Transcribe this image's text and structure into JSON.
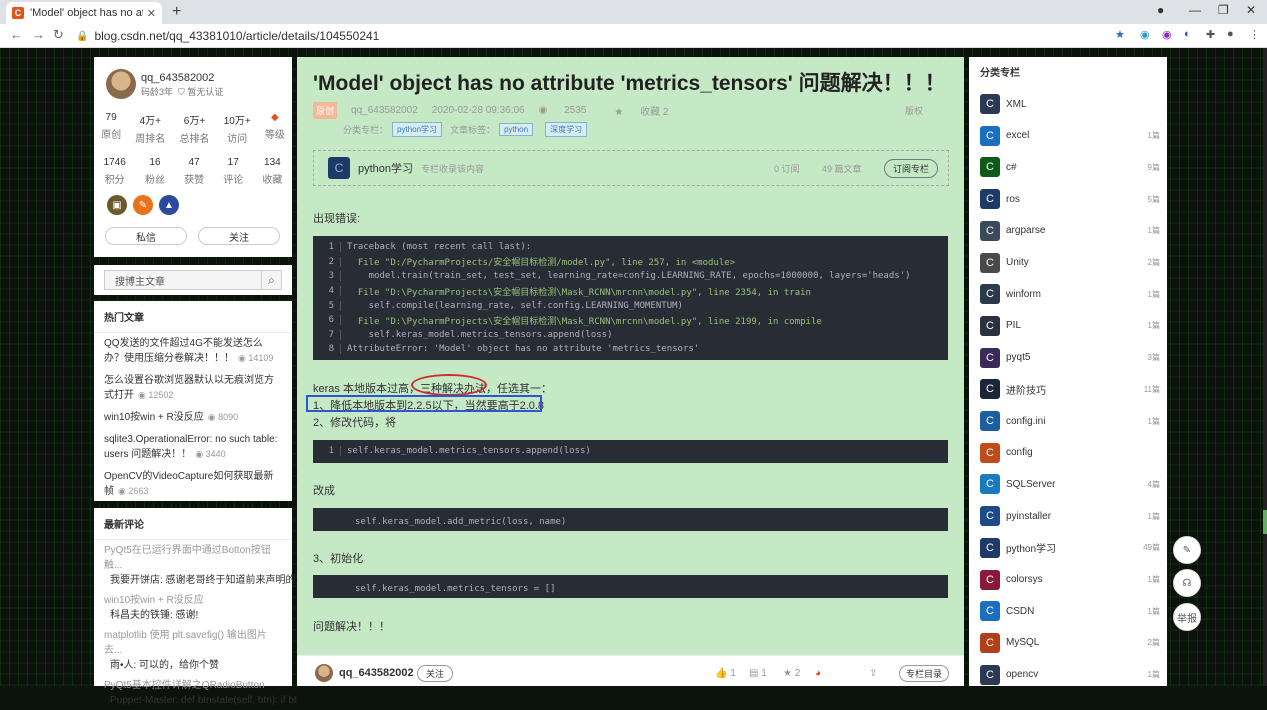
{
  "browser": {
    "tab_title": "'Model' object has no attribut",
    "tab_favicon": "C",
    "tab_close": "✕",
    "new_tab": "+",
    "url": "blog.csdn.net/qq_43381010/article/details/104550241",
    "icons": [
      "back-icon",
      "forward-icon",
      "reload-icon",
      "lock-icon",
      "star-icon",
      "extension-icon",
      "profile-icon",
      "menu-icon"
    ]
  },
  "profile": {
    "username": "qq_643582002",
    "code_age": "码龄3年",
    "verify": "暂无认证",
    "stats_row1": [
      {
        "value": "79",
        "label": "原创"
      },
      {
        "value": "4万+",
        "label": "周排名"
      },
      {
        "value": "6万+",
        "label": "总排名"
      },
      {
        "value": "10万+",
        "label": "访问"
      },
      {
        "value": "",
        "label": "等级"
      }
    ],
    "stats_row2": [
      {
        "value": "1746",
        "label": "积分"
      },
      {
        "value": "16",
        "label": "粉丝"
      },
      {
        "value": "47",
        "label": "获赞"
      },
      {
        "value": "17",
        "label": "评论"
      },
      {
        "value": "134",
        "label": "收藏"
      }
    ],
    "message_btn": "私信",
    "follow_btn": "关注"
  },
  "search": {
    "placeholder": "搜博主文章"
  },
  "hot": {
    "title": "热门文章",
    "items": [
      {
        "title": "QQ发送的文件超过4G不能发送怎么办？使用压缩分卷解决！！！",
        "count": "14109"
      },
      {
        "title": "怎么设置谷歌浏览器默认以无痕浏览方式打开",
        "count": "12502"
      },
      {
        "title": "win10按win + R没反应",
        "count": "8090"
      },
      {
        "title": "sqlite3.OperationalError: no such table: users 问题解决！！",
        "count": "3440"
      },
      {
        "title": "OpenCV的VideoCapture如何获取最新帧",
        "count": "2663"
      }
    ]
  },
  "latest": {
    "title": "最新评论",
    "items": [
      {
        "title": "PyQt5在已运行界面中通过Botton按钮触...",
        "comment": "我要开饼店: 感谢老哥终于知道前来声明的为什么都看不到了 hhh"
      },
      {
        "title": "win10按win + R没反应",
        "comment": "科昌夫的铁锤: 感谢!"
      },
      {
        "title": "matplotlib 使用 plt.savefig() 输出图片去...",
        "comment": "雨•人: 可以的，给你个赞"
      },
      {
        "title": "PyQt5基本控件详解之QRadioButton",
        "comment": "Puppet-Master: def btnstate(self, btn): if bt"
      }
    ]
  },
  "article": {
    "title": "'Model' object has no attribute 'metrics_tensors' 问题解决！！！",
    "original": "原创",
    "author": "qq_643582002",
    "date": "2020-02-28 09:36:06",
    "views": "2535",
    "favorites": "收藏 2",
    "copyright": "版权",
    "category_label": "分类专栏：",
    "category": "python学习",
    "tags_label": "文章标签：",
    "tags": [
      "python",
      "深度学习"
    ],
    "column": {
      "name": "python学习",
      "desc": "专栏收录该内容",
      "subs": "0 订阅",
      "count": "49 篇文章",
      "btn": "订阅专栏"
    },
    "p_error": "出现错误:",
    "code1": [
      [
        "1",
        "Traceback (most recent call last):"
      ],
      [
        "2",
        "  File \"D:/PycharmProjects/安全帽目标检测/model.py\", line 257, in <module>"
      ],
      [
        "3",
        "    model.train(train_set, test_set, learning_rate=config.LEARNING_RATE, epochs=1000000, layers='heads')"
      ],
      [
        "4",
        "  File \"D:\\PycharmProjects\\安全帽目标检测\\Mask_RCNN\\mrcnn\\model.py\", line 2354, in train"
      ],
      [
        "5",
        "    self.compile(learning_rate, self.config.LEARNING_MOMENTUM)"
      ],
      [
        "6",
        "  File \"D:\\PycharmProjects\\安全帽目标检测\\Mask_RCNN\\mrcnn\\model.py\", line 2199, in compile"
      ],
      [
        "7",
        "    self.keras_model.metrics_tensors.append(loss)"
      ],
      [
        "8",
        "AttributeError: 'Model' object has no attribute 'metrics_tensors'"
      ]
    ],
    "p_keras_a": "keras 本地版本过高，",
    "p_keras_b": "三种解决办法",
    "p_keras_c": "，任选其一：",
    "p_opt1": "1、降低本地版本到2.2.5以下，当然要高于2.0.8",
    "p_opt2": "2、修改代码，将",
    "code2": [
      [
        "1",
        "self.keras_model.metrics_tensors.append(loss)"
      ]
    ],
    "p_change": "改成",
    "code3": "self.keras_model.add_metric(loss, name)",
    "p_opt3": "3、初始化",
    "code4": "self.keras_model.metrics_tensors = []",
    "p_done": "问题解决！！！"
  },
  "bottom": {
    "author": "qq_643582002",
    "follow": "关注",
    "likes": "1",
    "comments": "1",
    "stars": "2",
    "directory": "专栏目录"
  },
  "columns": {
    "title": "分类专栏",
    "items": [
      {
        "name": "XML",
        "count": "",
        "color": "#2a3a55"
      },
      {
        "name": "excel",
        "count": "1篇",
        "color": "#1a6fc0"
      },
      {
        "name": "c#",
        "count": "9篇",
        "color": "#0f5a18"
      },
      {
        "name": "ros",
        "count": "5篇",
        "color": "#1d3b66"
      },
      {
        "name": "argparse",
        "count": "1篇",
        "color": "#3a4a5a"
      },
      {
        "name": "Unity",
        "count": "2篇",
        "color": "#4a4a4a"
      },
      {
        "name": "winform",
        "count": "1篇",
        "color": "#2a3a4a"
      },
      {
        "name": "PIL",
        "count": "1篇",
        "color": "#2b3140"
      },
      {
        "name": "pyqt5",
        "count": "3篇",
        "color": "#3a2a5a"
      },
      {
        "name": "进阶技巧",
        "count": "11篇",
        "color": "#1b2638"
      },
      {
        "name": "config.ini",
        "count": "1篇",
        "color": "#1b5fa0"
      },
      {
        "name": "config",
        "count": "",
        "color": "#c04a1a"
      },
      {
        "name": "SQLServer",
        "count": "4篇",
        "color": "#1a7ac0"
      },
      {
        "name": "pyinstaller",
        "count": "1篇",
        "color": "#1d4b8a"
      },
      {
        "name": "python学习",
        "count": "49篇",
        "color": "#1d3b66"
      },
      {
        "name": "colorsys",
        "count": "1篇",
        "color": "#8a1a3a"
      },
      {
        "name": "CSDN",
        "count": "1篇",
        "color": "#1a6fc0"
      },
      {
        "name": "MySQL",
        "count": "2篇",
        "color": "#b0401a"
      },
      {
        "name": "opencv",
        "count": "1篇",
        "color": "#2a3a55"
      }
    ]
  },
  "float_buttons": {
    "report": "举报"
  }
}
